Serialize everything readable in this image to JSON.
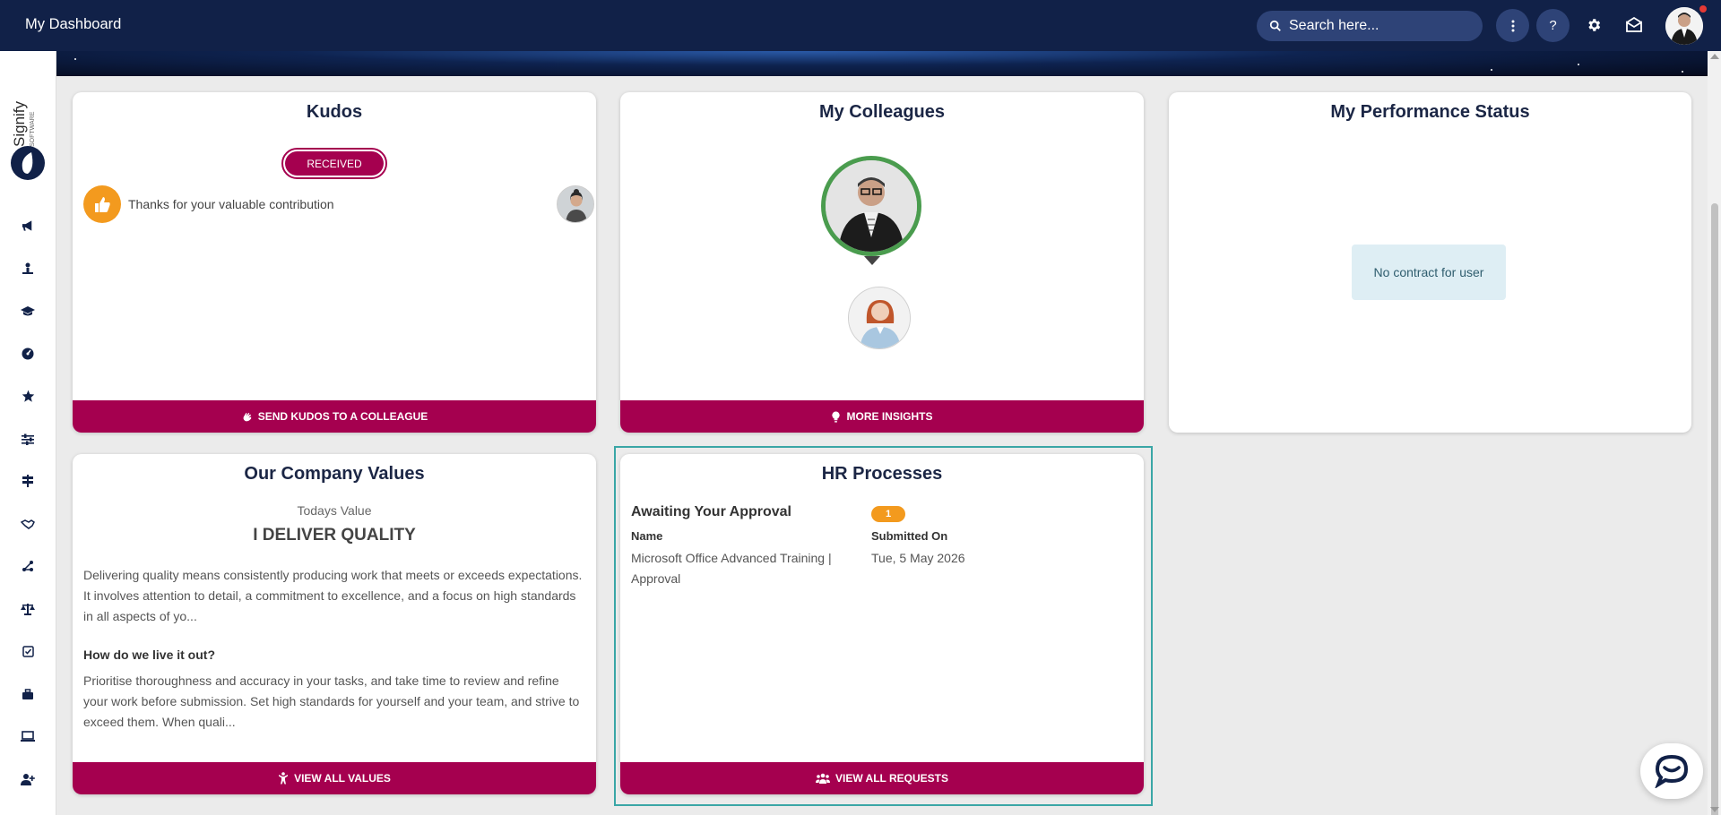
{
  "header": {
    "title": "My Dashboard",
    "search_placeholder": "Search here...",
    "icons": [
      "search-icon",
      "more-vertical-icon",
      "help-icon",
      "gear-icon",
      "mail-icon",
      "user-avatar"
    ],
    "help_label": "?"
  },
  "sidebar": {
    "logo": "Signify Software",
    "items": [
      "megaphone-icon",
      "person-icon",
      "graduation-icon",
      "dashboard-icon",
      "star-icon",
      "sliders-icon",
      "signpost-icon",
      "handshake-icon",
      "network-icon",
      "scale-icon",
      "checklist-icon",
      "briefcase-icon",
      "laptop-icon",
      "user-plus-icon"
    ]
  },
  "kudos": {
    "title": "Kudos",
    "tab_label": "RECEIVED",
    "message": "Thanks for your valuable contribution",
    "footer_label": "SEND KUDOS TO A COLLEAGUE"
  },
  "colleagues": {
    "title": "My Colleagues",
    "footer_label": "MORE INSIGHTS"
  },
  "performance": {
    "title": "My Performance Status",
    "message": "No contract for user"
  },
  "values": {
    "title": "Our Company Values",
    "subtitle": "Todays Value",
    "value_name": "I DELIVER QUALITY",
    "description": "Delivering quality means consistently producing work that meets or exceeds expectations. It involves attention to detail, a commitment to excellence, and a focus on high standards in all aspects of yo...",
    "how_heading": "How do we live it out?",
    "how_text": "Prioritise thoroughness and accuracy in your tasks, and take time to review and refine your work before submission. Set high standards for yourself and your team, and strive to exceed them. When quali...",
    "footer_label": "VIEW ALL VALUES"
  },
  "hr": {
    "title": "HR Processes",
    "section": "Awaiting Your Approval",
    "count": "1",
    "col_name": "Name",
    "col_submitted": "Submitted On",
    "item_name": "Microsoft Office Advanced Training | Approval",
    "item_date": "Tue, 5 May 2026",
    "footer_label": "VIEW ALL REQUESTS"
  },
  "colors": {
    "header": "#112148",
    "accent": "#a5004f",
    "badge": "#f39a1e",
    "highlight": "#3aa6a6"
  }
}
